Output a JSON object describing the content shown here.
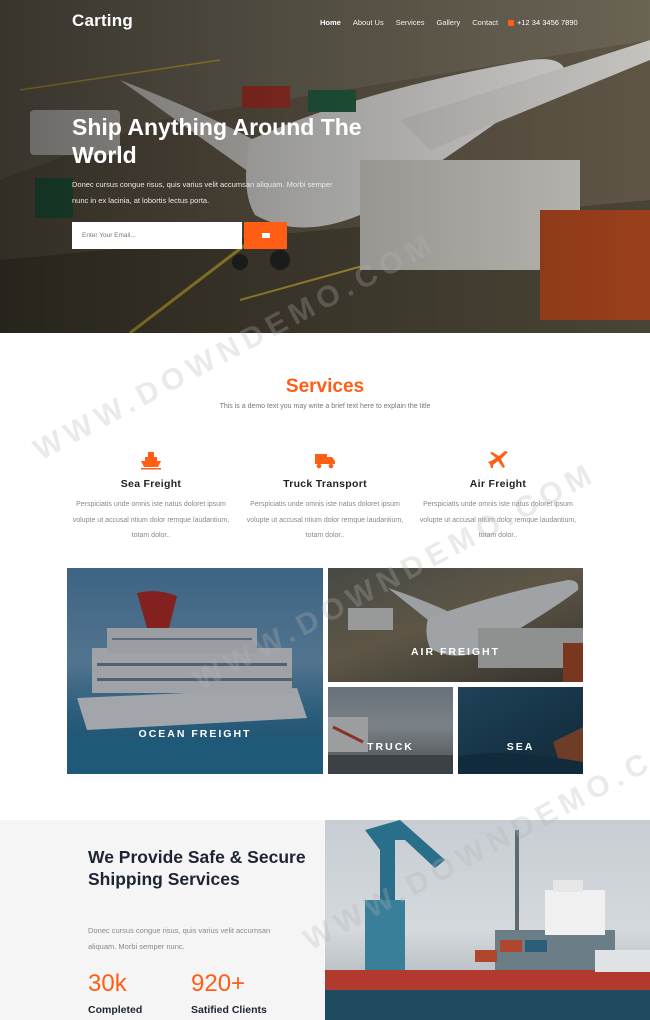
{
  "nav": {
    "logo": "Carting",
    "links": [
      "Home",
      "About Us",
      "Services",
      "Gallery",
      "Contact"
    ],
    "phone": "+12 34 3456 7890"
  },
  "hero": {
    "title": "Ship Anything Around The World",
    "text": "Donec cursus congue risus, quis varius velit accumsan aliquam. Morbi semper nunc in ex lacinia, at lobortis lectus porta.",
    "email_placeholder": "Enter Your Email..."
  },
  "services": {
    "title": "Services",
    "subtitle": "This is a demo text you may write a brief text here to explain the title",
    "items": [
      {
        "name": "Sea Freight",
        "text": "Perspiciatis unde omnis iste natus doloret ipsum volupte ut accusal ntium dolor remque laudantium, totam dolor.."
      },
      {
        "name": "Truck Transport",
        "text": "Perspiciatis unde omnis iste natus doloret ipsum volupte ut accusal ntium dolor remque laudantium, totam dolor.."
      },
      {
        "name": "Air Freight",
        "text": "Perspiciatis unde omnis iste natus doloret ipsum volupte ut accusal ntium dolor remque laudantium, totam dolor.."
      }
    ]
  },
  "gallery": {
    "ocean": "OCEAN FREIGHT",
    "air": "AIR FREIGHT",
    "truck": "TRUCK",
    "sea": "SEA"
  },
  "about": {
    "title": "We Provide Safe & Secure Shipping Services",
    "text": "Donec cursus congue risus, quis varius velit accumsan aliquam. Morbi semper nunc.",
    "stats": [
      {
        "value": "30k",
        "label": "Completed"
      },
      {
        "value": "920+",
        "label": "Satified Clients"
      }
    ]
  },
  "watermark": "WWW.DOWNDEMO.COM",
  "colors": {
    "accent": "#ff5e14",
    "dark": "#1e2433"
  }
}
